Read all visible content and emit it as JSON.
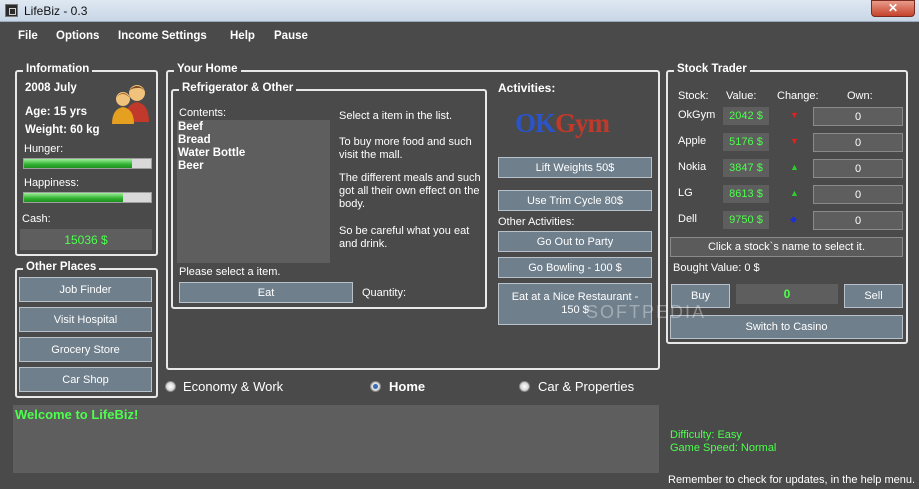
{
  "window": {
    "title": "LifeBiz - 0.3",
    "close": "✕"
  },
  "menu": [
    "File",
    "Options",
    "Income Settings",
    "Help",
    "Pause"
  ],
  "info": {
    "title": "Information",
    "date": "2008 July",
    "age": "Age:  15 yrs",
    "weight": "Weight:  60 kg",
    "hunger_label": "Hunger:",
    "hunger_level": 0.85,
    "happiness_label": "Happiness:",
    "happiness_level": 0.78,
    "cash_label": "Cash:",
    "cash": "15036 $"
  },
  "places": {
    "title": "Other Places",
    "buttons": [
      "Job Finder",
      "Visit Hospital",
      "Grocery Store",
      "Car Shop"
    ]
  },
  "home": {
    "title": "Your Home",
    "fridge_title": "Refrigerator & Other",
    "contents_label": "Contents:",
    "items": [
      "Beef",
      "Bread",
      "Water Bottle",
      "Beer"
    ],
    "help1": "Select a item in the list.",
    "help2": "To buy more food and such visit the mall.",
    "help3": "The different meals and such got all their own effect on the body.",
    "help4": "So be careful what you eat and drink.",
    "select_prompt": "Please select a item.",
    "eat": "Eat",
    "quantity_label": "Quantity:",
    "activities_title": "Activities:",
    "logo_text": "OKGym",
    "activities": [
      "Lift Weights 50$",
      "Use Trim Cycle 80$"
    ],
    "other_title": "Other Activities:",
    "other_activities": [
      "Go Out to Party",
      "Go Bowling - 100 $",
      "Eat at a Nice Restaurant - 150 $"
    ]
  },
  "tabs": {
    "economy": "Economy & Work",
    "home": "Home",
    "car": "Car & Properties"
  },
  "stock": {
    "title": "Stock Trader",
    "headers": [
      "Stock:",
      "Value:",
      "Change:",
      "Own:"
    ],
    "rows": [
      {
        "name": "OkGym",
        "value": "2042 $",
        "change": "▼",
        "change_color": "#e02020",
        "own": "0"
      },
      {
        "name": "Apple",
        "value": "5176 $",
        "change": "▼",
        "change_color": "#e02020",
        "own": "0"
      },
      {
        "name": "Nokia",
        "value": "3847 $",
        "change": "▲",
        "change_color": "#2ecc2e",
        "own": "0"
      },
      {
        "name": "LG",
        "value": "8613 $",
        "change": "▲",
        "change_color": "#2ecc2e",
        "own": "0"
      },
      {
        "name": "Dell",
        "value": "9750 $",
        "change": "◆",
        "change_color": "#1f2fd6",
        "own": "0"
      }
    ],
    "hint": "Click a stock`s name to select it.",
    "bought_value": "Bought Value: 0 $",
    "buy": "Buy",
    "amount": "0",
    "sell": "Sell",
    "casino": "Switch to Casino"
  },
  "status": {
    "welcome": "Welcome to LifeBiz!",
    "difficulty": "Difficulty: Easy",
    "game_speed": "Game Speed: Normal",
    "update_note": "Remember to check for updates, in the help menu."
  },
  "watermark": "SOFTPEDIA"
}
